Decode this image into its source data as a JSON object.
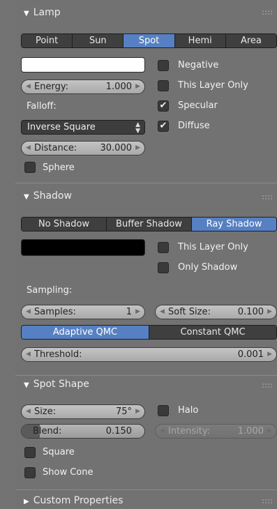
{
  "lamp": {
    "title": "Lamp",
    "types": [
      "Point",
      "Sun",
      "Spot",
      "Hemi",
      "Area"
    ],
    "active_type": "Spot",
    "color": "#ffffff",
    "energy_label": "Energy:",
    "energy_value": "1.000",
    "falloff_label": "Falloff:",
    "falloff_value": "Inverse Square",
    "distance_label": "Distance:",
    "distance_value": "30.000",
    "sphere_label": "Sphere",
    "sphere_checked": false,
    "negative_label": "Negative",
    "negative_checked": false,
    "this_layer_only_label": "This Layer Only",
    "this_layer_only_checked": false,
    "specular_label": "Specular",
    "specular_checked": true,
    "diffuse_label": "Diffuse",
    "diffuse_checked": true
  },
  "shadow": {
    "title": "Shadow",
    "modes": [
      "No Shadow",
      "Buffer Shadow",
      "Ray Shadow"
    ],
    "active_mode": "Ray Shadow",
    "color": "#000000",
    "this_layer_only_label": "This Layer Only",
    "only_shadow_label": "Only Shadow",
    "sampling_label": "Sampling:",
    "samples_label": "Samples:",
    "samples_value": "1",
    "soft_size_label": "Soft Size:",
    "soft_size_value": "0.100",
    "qmc_modes": [
      "Adaptive QMC",
      "Constant QMC"
    ],
    "active_qmc": "Adaptive QMC",
    "threshold_label": "Threshold:",
    "threshold_value": "0.001"
  },
  "spot_shape": {
    "title": "Spot Shape",
    "size_label": "Size:",
    "size_value": "75°",
    "blend_label": "Blend:",
    "blend_value": "0.150",
    "blend_fraction": 0.15,
    "halo_label": "Halo",
    "intensity_label": "Intensity:",
    "intensity_value": "1.000",
    "square_label": "Square",
    "show_cone_label": "Show Cone"
  },
  "custom_properties": {
    "title": "Custom Properties"
  },
  "colors": {
    "accent": "#5680c2",
    "panel": "#727272",
    "widget": "#3f3f3f"
  }
}
